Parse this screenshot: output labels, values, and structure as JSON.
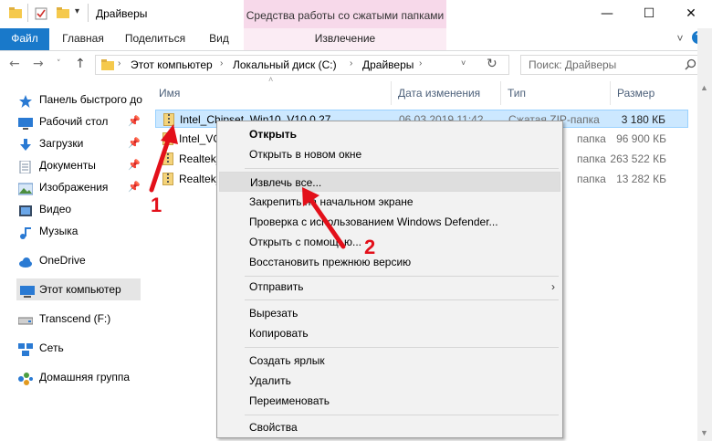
{
  "window": {
    "title": "Драйверы",
    "context_tab_title": "Средства работы со сжатыми папками",
    "controls": {
      "minimize": "—",
      "maximize": "☐",
      "close": "✕"
    }
  },
  "ribbon": {
    "tabs": [
      "Файл",
      "Главная",
      "Поделиться",
      "Вид",
      "Извлечение"
    ],
    "expand_icon": "˅",
    "help_icon": "?"
  },
  "address_bar": {
    "crumbs": [
      "Этот компьютер",
      "Локальный диск (C:)",
      "Драйверы"
    ],
    "search_placeholder": "Поиск: Драйверы"
  },
  "nav_pane": {
    "items": [
      {
        "label": "Панель быстрого доступа",
        "icon": "star-icon"
      },
      {
        "label": "Рабочий стол",
        "icon": "desktop-icon",
        "pinned": true
      },
      {
        "label": "Загрузки",
        "icon": "download-icon",
        "pinned": true
      },
      {
        "label": "Документы",
        "icon": "documents-icon",
        "pinned": true
      },
      {
        "label": "Изображения",
        "icon": "pictures-icon",
        "pinned": true
      },
      {
        "label": "Видео",
        "icon": "video-icon"
      },
      {
        "label": "Музыка",
        "icon": "music-icon"
      },
      {
        "label": "OneDrive",
        "icon": "cloud-icon"
      },
      {
        "label": "Этот компьютер",
        "icon": "computer-icon",
        "selected": true
      },
      {
        "label": "Transcend (F:)",
        "icon": "drive-icon"
      },
      {
        "label": "Сеть",
        "icon": "network-icon"
      },
      {
        "label": "Домашняя группа",
        "icon": "homegroup-icon"
      }
    ]
  },
  "file_list": {
    "columns": [
      "Имя",
      "Дата изменения",
      "Тип",
      "Размер"
    ],
    "rows": [
      {
        "name": "Intel_Chipset_Win10_V10.0.27",
        "date": "06.03.2019 11:42",
        "type": "Сжатая ZIP-папка",
        "size": "3 180 КБ",
        "selected": true
      },
      {
        "name": "Intel_VG",
        "date": "",
        "type": "папка",
        "size": "96 900 КБ"
      },
      {
        "name": "Realtek_",
        "date": "",
        "type": "папка",
        "size": "263 522 КБ"
      },
      {
        "name": "Realtek_",
        "date": "",
        "type": "папка",
        "size": "13 282 КБ"
      }
    ]
  },
  "context_menu": {
    "groups": [
      [
        {
          "label": "Открыть",
          "bold": true
        },
        {
          "label": "Открыть в новом окне"
        }
      ],
      [
        {
          "label": "Извлечь все...",
          "highlighted": true
        },
        {
          "label": "Закрепить на начальном экране"
        },
        {
          "label": "Проверка с использованием Windows Defender..."
        },
        {
          "label": "Открыть с помощью..."
        },
        {
          "label": "Восстановить прежнюю версию"
        }
      ],
      [
        {
          "label": "Отправить",
          "submenu": true
        }
      ],
      [
        {
          "label": "Вырезать"
        },
        {
          "label": "Копировать"
        }
      ],
      [
        {
          "label": "Создать ярлык"
        },
        {
          "label": "Удалить"
        },
        {
          "label": "Переименовать"
        }
      ],
      [
        {
          "label": "Свойства"
        }
      ]
    ]
  },
  "annotations": {
    "step1": "1",
    "step2": "2",
    "color": "#e3101a"
  },
  "colors": {
    "file_tab": "#1979ca",
    "context_tab": "#f7d9ea",
    "selection": "#cce8ff"
  }
}
